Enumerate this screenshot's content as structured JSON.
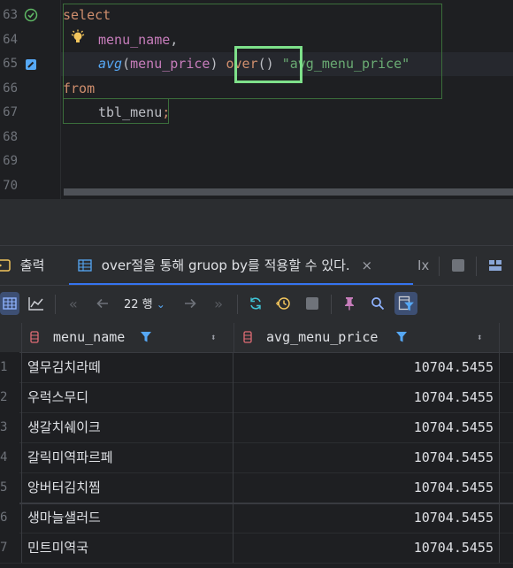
{
  "editor": {
    "line_numbers": [
      "63",
      "64",
      "65",
      "66",
      "67",
      "68",
      "69",
      "70"
    ],
    "line63": {
      "kw": "select"
    },
    "line64": {
      "col": "menu_name",
      "punct": ","
    },
    "line65": {
      "fn": "avg",
      "open": "(",
      "col": "menu_price",
      "close": ")",
      "kw": "over",
      "parens": "()",
      "alias": "\"avg_menu_price\""
    },
    "line66": {
      "kw": "from"
    },
    "line67": {
      "table": "tbl_menu",
      "semi": ";"
    }
  },
  "tabs": {
    "output_label": "출력",
    "result_label": "over절을 통해 gruop by를 적용할 수 있다.",
    "close": "×",
    "tx": "Ix"
  },
  "toolbar": {
    "rows_count": "22 행"
  },
  "grid": {
    "columns": [
      "menu_name",
      "avg_menu_price"
    ],
    "sort_glyph": "⬍",
    "rows": [
      {
        "n": "1",
        "name": "열무김치라떼",
        "avg": "10704.5455"
      },
      {
        "n": "2",
        "name": "우럭스무디",
        "avg": "10704.5455"
      },
      {
        "n": "3",
        "name": "생갈치쉐이크",
        "avg": "10704.5455"
      },
      {
        "n": "4",
        "name": "갈릭미역파르페",
        "avg": "10704.5455"
      },
      {
        "n": "5",
        "name": "앙버터김치찜",
        "avg": "10704.5455"
      },
      {
        "n": "6",
        "name": "생마늘샐러드",
        "avg": "10704.5455"
      },
      {
        "n": "7",
        "name": "민트미역국",
        "avg": "10704.5455"
      }
    ]
  },
  "colors": {
    "accent": "#3574f0",
    "keyword": "#cf8e6d",
    "function": "#56a8f5",
    "column": "#c77dbb",
    "string": "#6aab73",
    "highlight": "#7ee08a"
  }
}
